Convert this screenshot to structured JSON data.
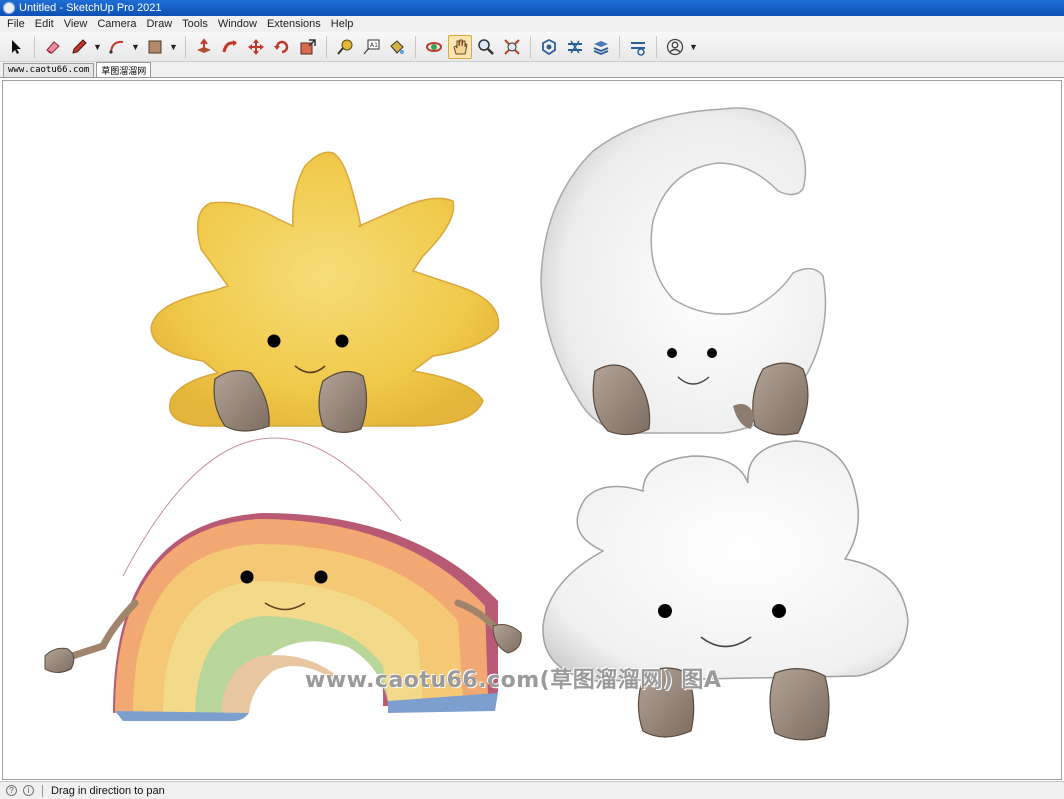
{
  "window": {
    "title": "Untitled - SketchUp Pro 2021"
  },
  "menu": [
    "File",
    "Edit",
    "View",
    "Camera",
    "Draw",
    "Tools",
    "Window",
    "Extensions",
    "Help"
  ],
  "toolbar_icons": [
    "select-icon",
    "eraser-icon",
    "pencil-line-icon",
    "arc-icon",
    "rectangle-shape-icon",
    "push-pull-icon",
    "follow-me-icon",
    "move-icon",
    "rotate-icon",
    "scale-icon",
    "tape-measure-icon",
    "text-icon",
    "paint-bucket-icon",
    "orbit-icon",
    "pan-icon",
    "zoom-icon",
    "zoom-extents-icon",
    "3d-warehouse-icon",
    "extension-warehouse-icon",
    "layout-icon",
    "extension-manager-icon",
    "account-icon"
  ],
  "scene_tabs": [
    "www.caotu66.com",
    "草图溜溜网"
  ],
  "watermark": "www.caotu66.com(草图溜溜网) 图A",
  "status": {
    "text": "Drag in direction to pan"
  },
  "colors": {
    "titlebar": "#0d4fb3",
    "sun": "#f2cf55",
    "moon": "#f3f3f3",
    "cloud": "#f5f5f5",
    "feet": "#9a8a7c"
  }
}
